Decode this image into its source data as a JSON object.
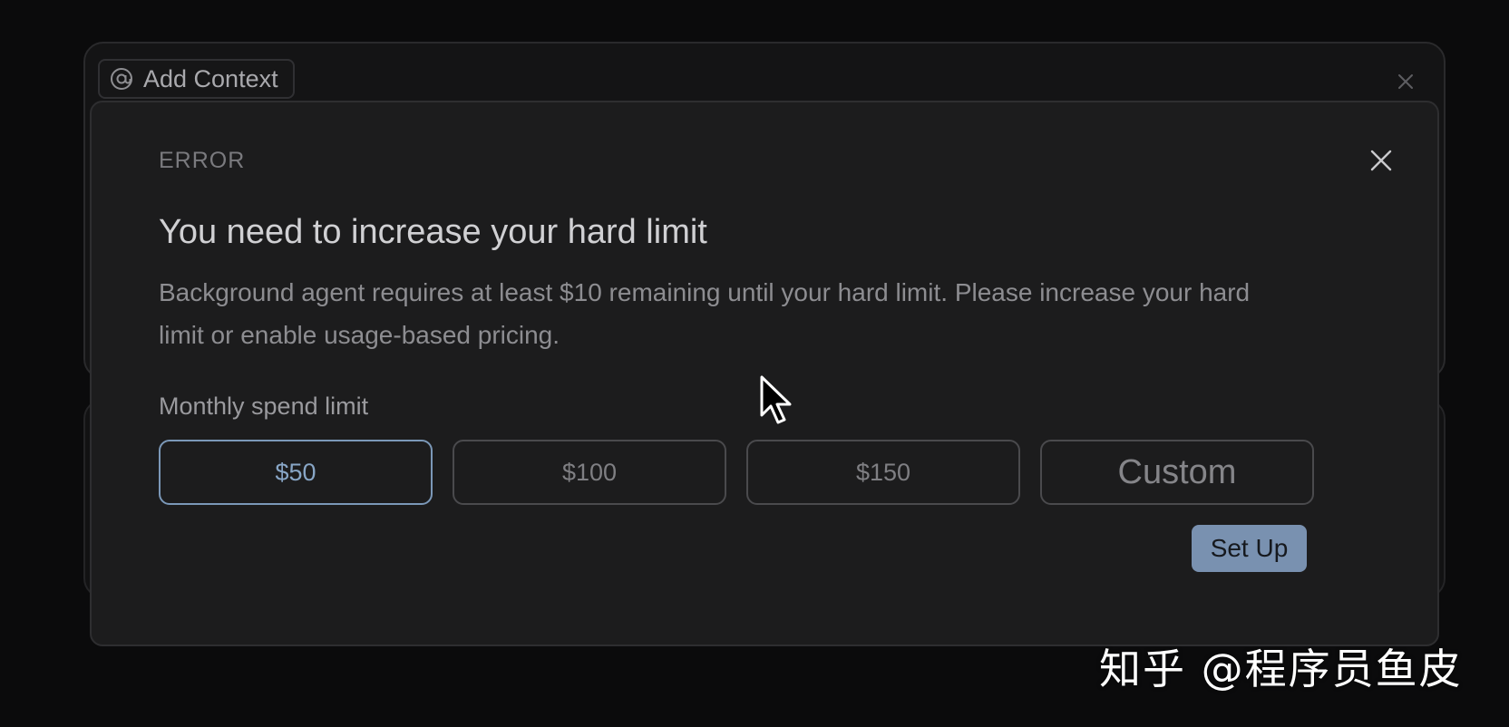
{
  "context_bar": {
    "add_context_label": "Add Context",
    "at_icon": "at-sign-icon",
    "close_icon": "close-icon"
  },
  "modal": {
    "label": "ERROR",
    "title": "You need to increase your hard limit",
    "description": "Background agent requires at least $10 remaining until your hard limit. Please increase your hard limit or enable usage-based pricing.",
    "spend_limit_label": "Monthly spend limit",
    "options": [
      {
        "label": "$50",
        "selected": true
      },
      {
        "label": "$100",
        "selected": false
      },
      {
        "label": "$150",
        "selected": false
      },
      {
        "label": "Custom",
        "selected": false
      }
    ],
    "setup_label": "Set Up",
    "close_icon": "close-icon"
  },
  "watermark": "知乎 @程序员鱼皮",
  "colors": {
    "background": "#0b0b0c",
    "modal_bg": "#1c1c1d",
    "accent": "#7991b0",
    "selected_border": "#7b98b8"
  }
}
